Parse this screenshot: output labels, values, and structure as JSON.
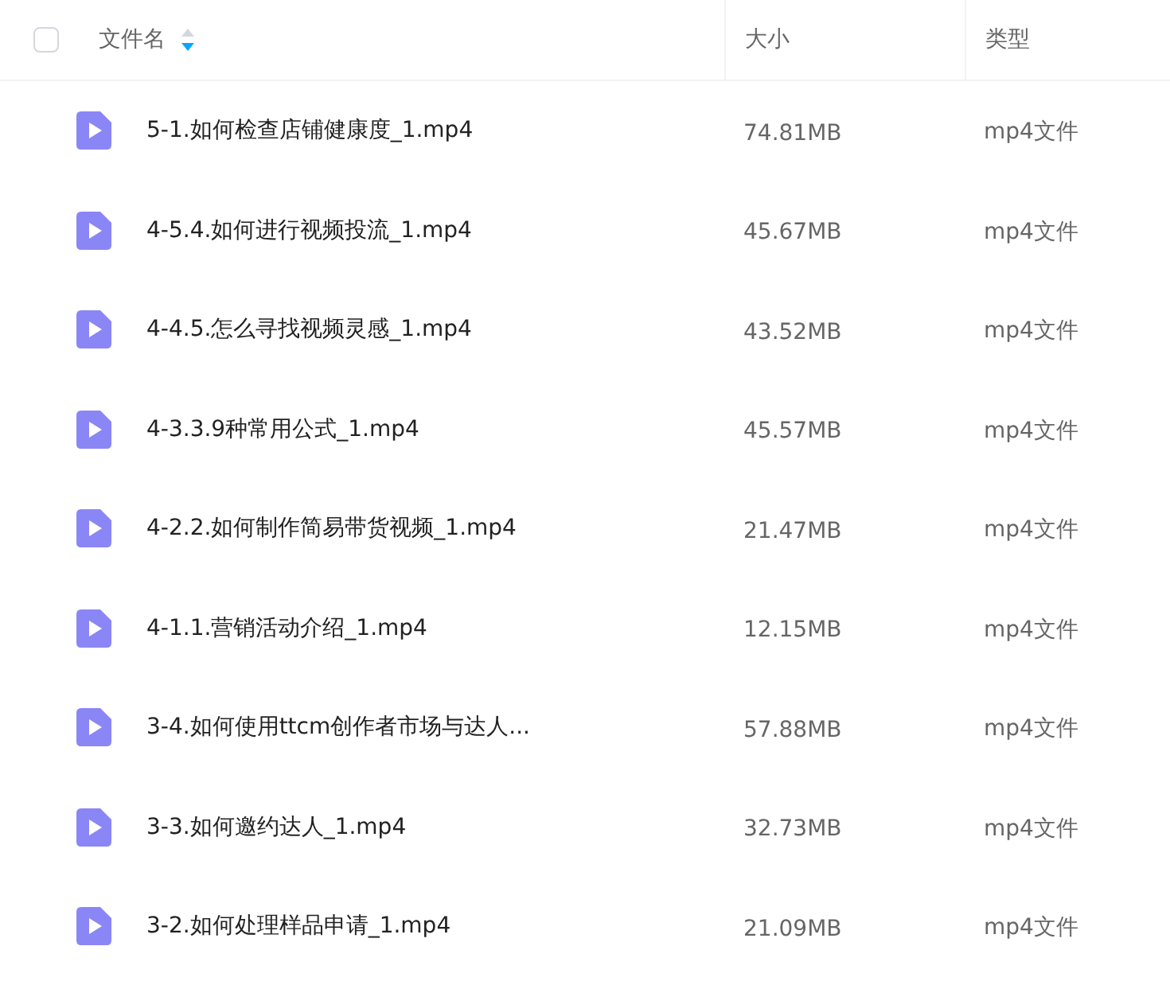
{
  "header": {
    "select_all": {
      "checked": false
    },
    "columns": [
      {
        "label": "文件名",
        "sorted": true,
        "descending": true
      },
      {
        "label": "大小"
      },
      {
        "label": "类型"
      }
    ]
  },
  "rows": [
    {
      "name": "5-1.如何检查店铺健康度_1.mp4",
      "size": "74.81MB",
      "type": "mp4文件"
    },
    {
      "name": "4-5.4.如何进行视频投流_1.mp4",
      "size": "45.67MB",
      "type": "mp4文件"
    },
    {
      "name": "4-4.5.怎么寻找视频灵感_1.mp4",
      "size": "43.52MB",
      "type": "mp4文件"
    },
    {
      "name": "4-3.3.9种常用公式_1.mp4",
      "size": "45.57MB",
      "type": "mp4文件"
    },
    {
      "name": "4-2.2.如何制作简易带货视频_1.mp4",
      "size": "21.47MB",
      "type": "mp4文件"
    },
    {
      "name": "4-1.1.营销活动介绍_1.mp4",
      "size": "12.15MB",
      "type": "mp4文件"
    },
    {
      "name": "3-4.如何使用ttcm创作者市场与达人...",
      "size": "57.88MB",
      "type": "mp4文件"
    },
    {
      "name": "3-3.如何邀约达人_1.mp4",
      "size": "32.73MB",
      "type": "mp4文件"
    },
    {
      "name": "3-2.如何处理样品申请_1.mp4",
      "size": "21.09MB",
      "type": "mp4文件"
    }
  ]
}
